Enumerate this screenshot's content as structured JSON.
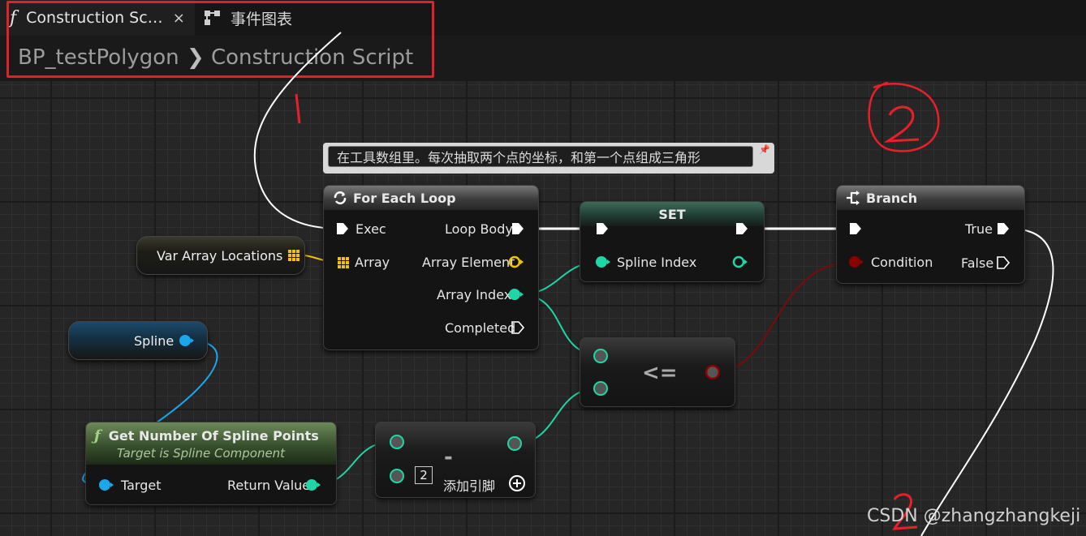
{
  "tabs": {
    "active": {
      "icon": "function-icon",
      "label": "Construction Sc…",
      "close": "×"
    },
    "other": {
      "icon": "event-graph-icon",
      "label": "事件图表"
    }
  },
  "breadcrumb": {
    "root": "BP_testPolygon",
    "separator": "❯",
    "current": "Construction Script"
  },
  "comment": {
    "text": "在工具数组里。每次抽取两个点的坐标，和第一个点组成三角形"
  },
  "nodes": {
    "for_each": {
      "title": "For Each Loop",
      "in_exec": "Exec",
      "in_array": "Array",
      "out_loop_body": "Loop Body",
      "out_array_element": "Array Element",
      "out_array_index": "Array Index",
      "out_completed": "Completed"
    },
    "set": {
      "title": "SET",
      "spline_index": "Spline Index"
    },
    "branch": {
      "title": "Branch",
      "condition": "Condition",
      "true": "True",
      "false": "False"
    },
    "var_array": {
      "label": "Var Array Locations"
    },
    "spline": {
      "label": "Spline"
    },
    "get_points": {
      "title": "Get Number Of Spline Points",
      "subtitle": "Target is Spline Component",
      "target": "Target",
      "return_value": "Return Value"
    },
    "subtract": {
      "title": "-",
      "constant": "2",
      "add_pin": "添加引脚"
    },
    "compare": {
      "title": "<="
    }
  },
  "annotations": {
    "one": "1",
    "two": "2",
    "three": "2"
  },
  "watermark": "CSDN @zhangzhangkeji",
  "colors": {
    "exec": "#ffffff",
    "integer": "#1fd6a6",
    "object": "#1aa7ec",
    "boolean": "#8b0000",
    "vector_array": "#f3c200",
    "annotation": "#e8202a"
  }
}
